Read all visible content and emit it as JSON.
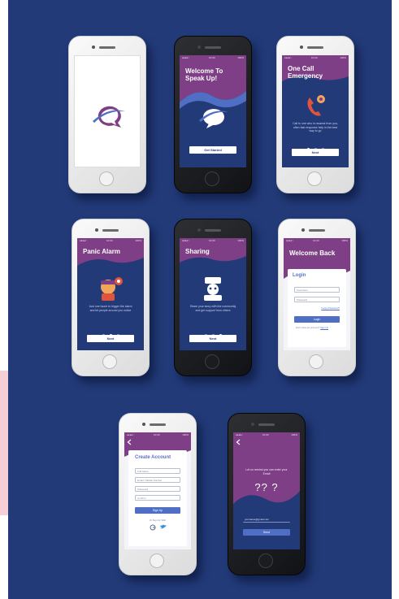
{
  "colors": {
    "navy": "#223a78",
    "purple": "#7e3f86",
    "accent": "#4f6fc4",
    "orange": "#f1a75b",
    "red": "#e0533d"
  },
  "status_bar": {
    "left": "●●●●○ ",
    "time": "10:30",
    "right": "100%"
  },
  "phones": {
    "splash": {
      "logo": "speech-bubble-logo"
    },
    "welcome": {
      "title": "Welcome To Speak Up!",
      "button": "Get Started"
    },
    "emergency": {
      "title": "One Call Emergency",
      "desc": "Call to one who is nearest from you, often fast response help is the best way to go",
      "button": "Next"
    },
    "panic": {
      "title": "Panic Alarm",
      "desc": "Just one touch to trigger the alarm and let people around you notice",
      "button": "Next"
    },
    "sharing": {
      "title": "Sharing",
      "desc": "Share your story with the community and get support from others",
      "button": "Next"
    },
    "login": {
      "title": "Welcome Back",
      "card_title": "Login",
      "username": "Username",
      "password": "Password",
      "forgot": "Forgot Password?",
      "button": "Login",
      "signup_prompt": "Don't have an account?",
      "signup_link": "Sign Up"
    },
    "create": {
      "title": "Create Account",
      "fields": [
        "Full Name",
        "Email / Mobile Number",
        "Password",
        "Confirm"
      ],
      "button": "Sign Up",
      "alt": "Or Sign Up With"
    },
    "forgot": {
      "desc": "Let us remind you can enter your Email",
      "marks": "?? ?",
      "email": "yourname@gmail.com",
      "button": "Send"
    }
  }
}
